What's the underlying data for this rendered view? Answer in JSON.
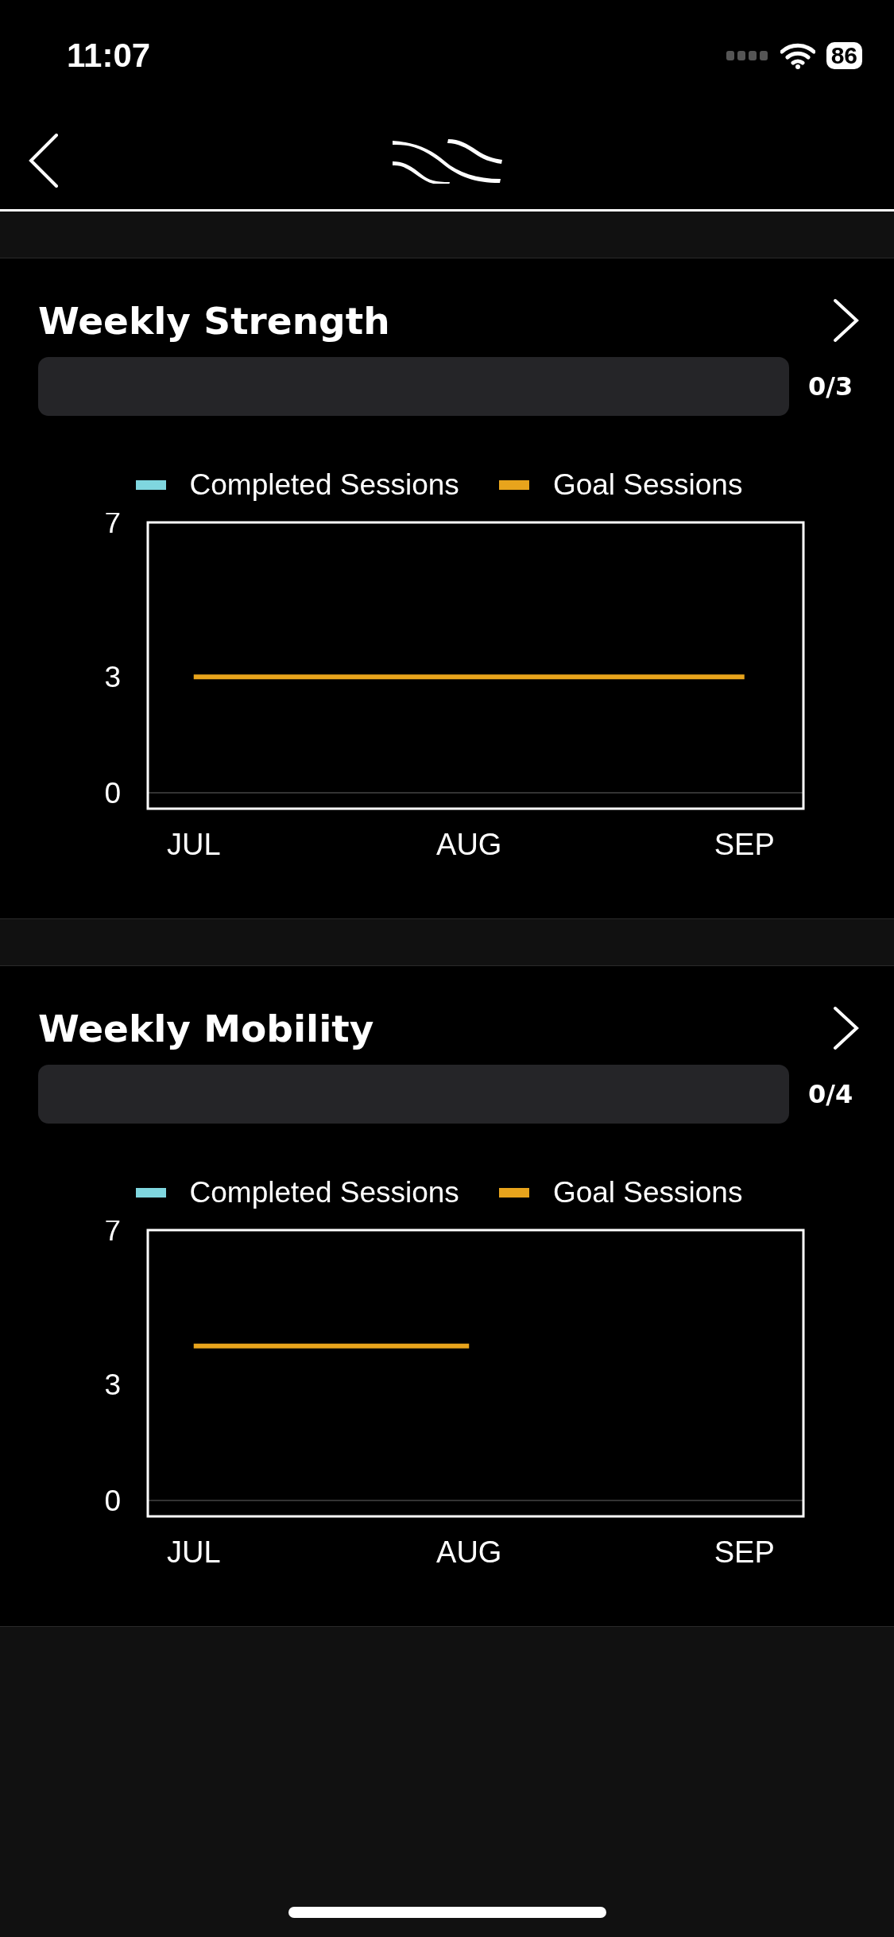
{
  "status_bar": {
    "time": "11:07",
    "battery": "86"
  },
  "cards": [
    {
      "title": "Weekly Strength",
      "progress": {
        "level": 0,
        "reading": "0/3"
      },
      "chart_data": {
        "type": "line",
        "categories": [
          "JUL",
          "AUG",
          "SEP"
        ],
        "ylim": [
          0,
          7
        ],
        "yticks": [
          0,
          3,
          7
        ],
        "series": [
          {
            "name": "Completed Sessions",
            "color": "#7fd6df",
            "values": [
              null,
              null,
              null
            ]
          },
          {
            "name": "Goal Sessions",
            "color": "#e8a41c",
            "values": [
              3,
              3,
              3
            ]
          }
        ]
      }
    },
    {
      "title": "Weekly Mobility",
      "progress": {
        "level": 0,
        "reading": "0/4"
      },
      "chart_data": {
        "type": "line",
        "categories": [
          "JUL",
          "AUG",
          "SEP"
        ],
        "ylim": [
          0,
          7
        ],
        "yticks": [
          0,
          3,
          7
        ],
        "series": [
          {
            "name": "Completed Sessions",
            "color": "#7fd6df",
            "values": [
              null,
              null,
              null
            ]
          },
          {
            "name": "Goal Sessions",
            "color": "#e8a41c",
            "values": [
              4,
              4,
              null
            ]
          }
        ]
      }
    }
  ]
}
